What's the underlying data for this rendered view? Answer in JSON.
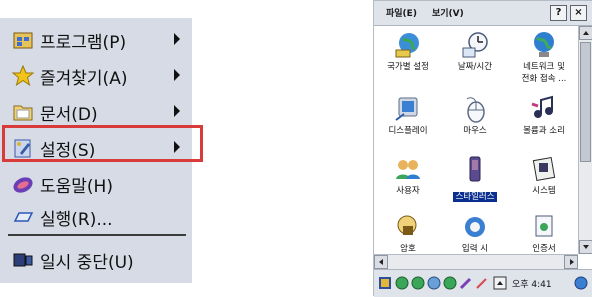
{
  "start_menu": {
    "items": [
      {
        "label": "프로그램(P)",
        "icon": "programs-icon",
        "has_submenu": true
      },
      {
        "label": "즐겨찾기(A)",
        "icon": "favorites-star-icon",
        "has_submenu": true
      },
      {
        "label": "문서(D)",
        "icon": "documents-folder-icon",
        "has_submenu": true
      },
      {
        "label": "설정(S)",
        "icon": "settings-icon",
        "has_submenu": true,
        "highlighted": true
      },
      {
        "label": "도움말(H)",
        "icon": "help-icon",
        "has_submenu": false
      },
      {
        "label": "실행(R)...",
        "icon": "run-icon",
        "has_submenu": false
      },
      {
        "label": "일시 중단(U)",
        "icon": "suspend-icon",
        "has_submenu": false
      }
    ],
    "highlight_color": "#d93b3b"
  },
  "control_panel": {
    "menubar": {
      "file_label": "파일(E)",
      "view_label": "보기(V)",
      "help_button": "?",
      "close_button": "×"
    },
    "items": [
      {
        "label": "국가별 설정",
        "icon": "regional-settings-icon"
      },
      {
        "label": "날짜/시간",
        "icon": "date-time-icon"
      },
      {
        "label": "네트워크 및",
        "label2": "전화 접속 ...",
        "icon": "network-icon"
      },
      {
        "label": "디스플레이",
        "icon": "display-icon"
      },
      {
        "label": "마우스",
        "icon": "mouse-icon"
      },
      {
        "label": "볼륨과 소리",
        "icon": "volume-sound-icon"
      },
      {
        "label": "사용자",
        "icon": "users-icon"
      },
      {
        "label": "스타일러스",
        "icon": "stylus-icon",
        "selected": true
      },
      {
        "label": "시스템",
        "icon": "system-icon"
      },
      {
        "label": "암호",
        "icon": "password-icon"
      },
      {
        "label": "입력 시",
        "icon": "input-icon"
      },
      {
        "label": "인증서",
        "icon": "certificates-icon"
      }
    ],
    "taskbar": {
      "time": "오후 4:41"
    },
    "selection_color": "#0a2f8f"
  }
}
